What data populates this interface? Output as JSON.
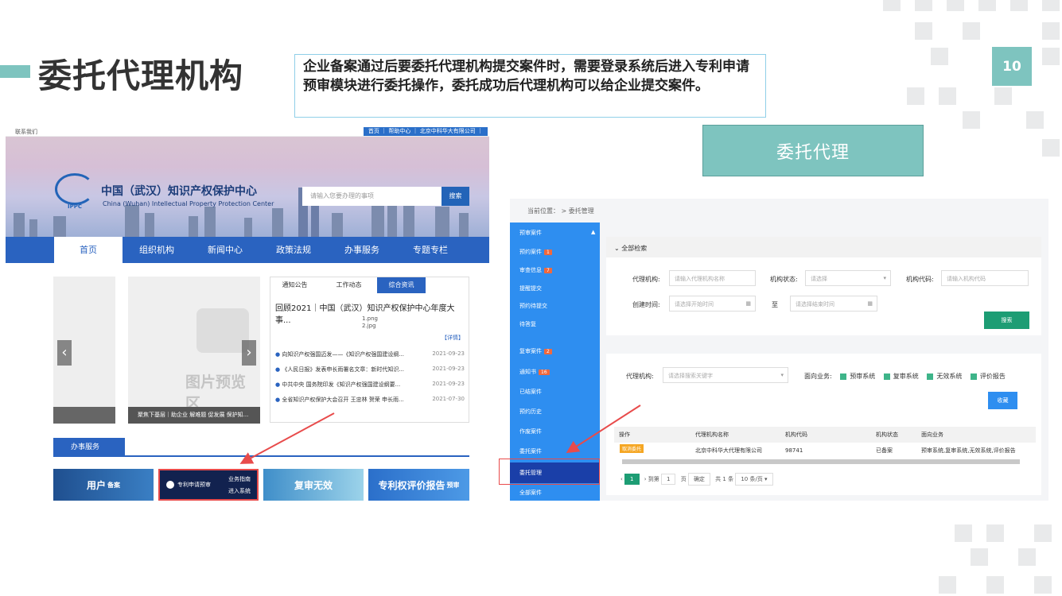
{
  "slide": {
    "title": "委托代理机构",
    "description": "企业备案通过后要委托代理机构提交案件时，需要登录系统后进入专利申请预审模块进行委托操作，委托成功后代理机构可以给企业提交案件。",
    "page_number": "10",
    "section_label": "委托代理"
  },
  "left_site": {
    "contact": "联系我们",
    "top_links": "首页 ｜ 帮助中心 ｜ 北京中科华大有限公司 ｜",
    "logo_text": "IPPC",
    "org_name": "中国（武汉）知识产权保护中心",
    "org_name_en": "China (Wuhan) Intellectual Property Protection Center",
    "search_placeholder": "请输入您要办理的事项",
    "search_button": "搜索",
    "nav": [
      "首页",
      "组织机构",
      "新闻中心",
      "政策法规",
      "办事服务",
      "专题专栏"
    ],
    "preview_text": "图片预览区",
    "preview_caption": "聚焦下基层｜助企业 解难题 促发展 保护知...",
    "news_tabs": [
      "通知公告",
      "工作动态",
      "综合资讯"
    ],
    "news_headline": "回顾2021｜中国（武汉）知识产权保护中心年度大事...",
    "news_files": [
      "1.png",
      "2.jpg"
    ],
    "news_detail": "【详情】",
    "news_items": [
      {
        "title": "向知识产权强国迈发——《知识产权强国建设纲...",
        "date": "2021-09-23"
      },
      {
        "title": "《人民日报》发表申长雨署名文章：新时代知识...",
        "date": "2021-09-23"
      },
      {
        "title": "中共中央 国务院印发《知识产权强国建设纲要...",
        "date": "2021-09-23"
      },
      {
        "title": "全省知识产权保护大会召开 王忠林 贺荣 申长雨...",
        "date": "2021-07-30"
      }
    ],
    "service_tab": "办事服务",
    "services": {
      "user": "用户",
      "user_sub": "备案",
      "predict": "专利申请预审",
      "guide": "业务指南",
      "enter": "进入系统",
      "reexam": "复审无效",
      "report": "专利权评价报告",
      "report_sub": "预审"
    }
  },
  "right_app": {
    "breadcrumb": "当前位置： >  委托管理",
    "sidebar": [
      {
        "label": "预审案件",
        "badge": ""
      },
      {
        "label": "预约案件",
        "badge": "1"
      },
      {
        "label": "审查信息",
        "badge": "7"
      },
      {
        "label": "提醒提交",
        "badge": ""
      },
      {
        "label": "预约待提交",
        "badge": ""
      },
      {
        "label": "待答复",
        "badge": ""
      },
      {
        "label": "复审案件",
        "badge": "2"
      },
      {
        "label": "通知书",
        "badge": "16"
      },
      {
        "label": "已结案件",
        "badge": ""
      },
      {
        "label": "预约历史",
        "badge": ""
      },
      {
        "label": "作废案件",
        "badge": ""
      },
      {
        "label": "委托案件",
        "badge": ""
      },
      {
        "label": "委托管理",
        "badge": ""
      },
      {
        "label": "全部案件",
        "badge": ""
      }
    ],
    "search_panel": {
      "head": "全部检索",
      "agency_label": "代理机构:",
      "agency_placeholder": "请输入代理机构名称",
      "status_label": "机构状态:",
      "status_placeholder": "请选择",
      "code_label": "机构代码:",
      "code_placeholder": "请输入机构代码",
      "time_label": "创建时间:",
      "start_placeholder": "请选择开始时间",
      "to": "至",
      "end_placeholder": "请选择结束时间",
      "search_button": "搜索"
    },
    "filter": {
      "agency_label": "代理机构:",
      "agency_placeholder": "请选择搜索关键字",
      "biz_label": "面向业务:",
      "options": [
        "预审系统",
        "复审系统",
        "无效系统",
        "评价报告"
      ],
      "collect_button": "收藏"
    },
    "table": {
      "headers": [
        "操作",
        "代理机构名称",
        "机构代码",
        "机构状态",
        "面向业务"
      ],
      "rows": [
        {
          "action": "取消委托",
          "name": "北京中科华大代理有限公司",
          "code": "98741",
          "status": "已备案",
          "biz": "预审系统,复审系统,无效系统,评价报告"
        }
      ]
    },
    "pager": {
      "current": "1",
      "goto": "到第",
      "page_input": "1",
      "page_unit": "页",
      "confirm": "确定",
      "total": "共 1 条",
      "per_page": "10 条/页"
    }
  },
  "colors": {
    "teal": "#7ec4bf",
    "blue": "#2a63c0",
    "app_blue": "#2e8ef0",
    "green": "#1d9d74",
    "red": "#e84b4b"
  }
}
